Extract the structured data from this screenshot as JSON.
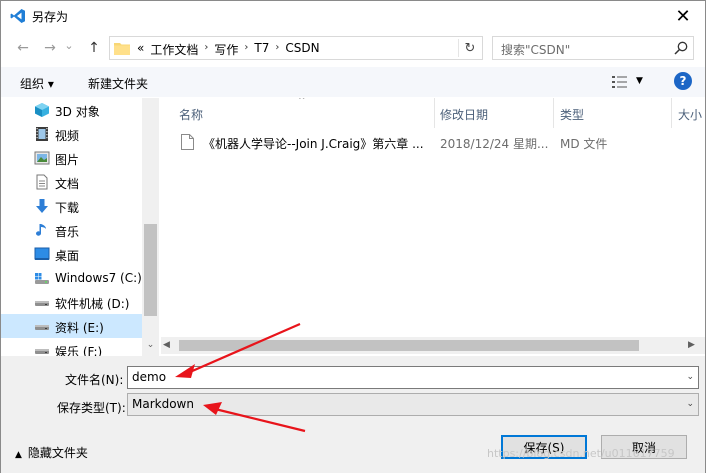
{
  "window": {
    "title": "另存为",
    "close_glyph": "✕"
  },
  "nav": {
    "back_glyph": "←",
    "forward_glyph": "→",
    "dropdown_glyph": "⌄",
    "up_glyph": "↑",
    "breadcrumbs": [
      "工作文档",
      "写作",
      "T7",
      "CSDN"
    ],
    "overflow_glyph": "«",
    "crumb_sep": "›",
    "refresh_glyph": "↻",
    "search_placeholder": "搜索\"CSDN\""
  },
  "toolbar": {
    "organize_label": "组织 ▾",
    "new_folder_label": "新建文件夹",
    "view_caret": "▼",
    "help_label": "?"
  },
  "sidebar": {
    "items": [
      {
        "label": "3D 对象",
        "icon": "3d-objects-icon"
      },
      {
        "label": "视频",
        "icon": "video-icon"
      },
      {
        "label": "图片",
        "icon": "pictures-icon"
      },
      {
        "label": "文档",
        "icon": "documents-icon"
      },
      {
        "label": "下载",
        "icon": "downloads-icon"
      },
      {
        "label": "音乐",
        "icon": "music-icon"
      },
      {
        "label": "桌面",
        "icon": "desktop-icon"
      },
      {
        "label": "Windows7 (C:)",
        "icon": "system-drive-icon"
      },
      {
        "label": "软件机械 (D:)",
        "icon": "drive-icon"
      },
      {
        "label": "资料 (E:)",
        "icon": "drive-icon",
        "selected": true
      },
      {
        "label": "娱乐 (F:)",
        "icon": "drive-icon"
      }
    ]
  },
  "filelist": {
    "sort_caret": "^",
    "columns": [
      "名称",
      "修改日期",
      "类型",
      "大小"
    ],
    "rows": [
      {
        "name": "《机器人学导论--Join J.Craig》第六章 ...",
        "modified": "2018/12/24 星期...",
        "type": "MD 文件"
      }
    ]
  },
  "form": {
    "filename_label": "文件名(N):",
    "filename_value": "demo",
    "filetype_label": "保存类型(T):",
    "filetype_value": "Markdown",
    "caret": "⌄"
  },
  "footer": {
    "hide_folders_label": "隐藏文件夹",
    "hide_caret": "▲",
    "save_label": "保存(S)",
    "cancel_label": "取消",
    "watermark": "https://blog.csdn.net/u011617759"
  },
  "colors": {
    "accent": "#0078d7",
    "arrow": "#e8141b",
    "selected": "#cce8ff"
  }
}
